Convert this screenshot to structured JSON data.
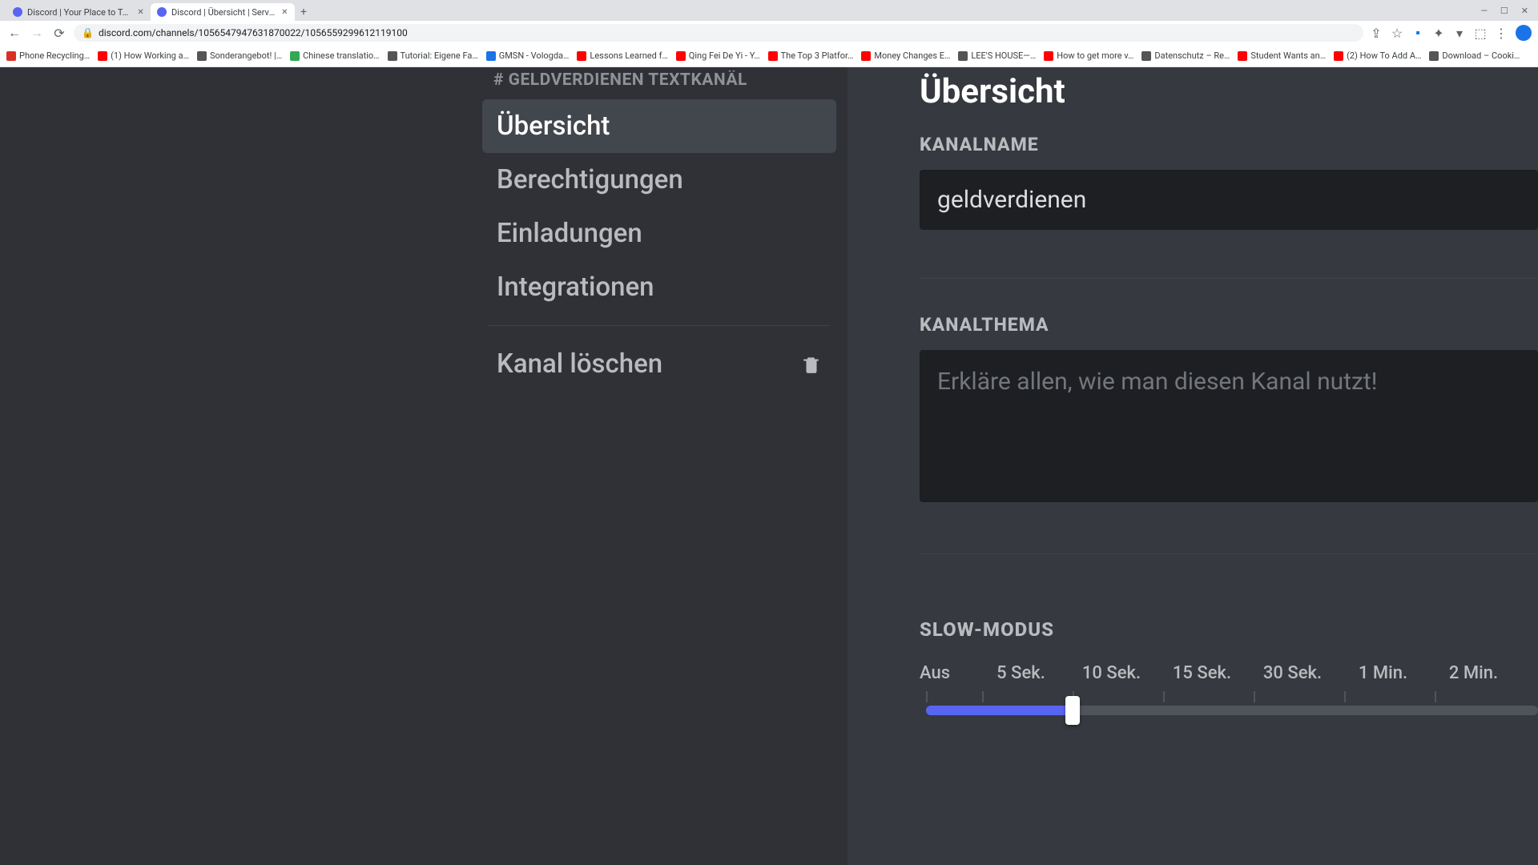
{
  "browser": {
    "tabs": [
      {
        "title": "Discord | Your Place to Talk an"
      },
      {
        "title": "Discord | Übersicht | Server v"
      }
    ],
    "url": "discord.com/channels/1056547947631870022/1056559299612119100",
    "bookmarks": [
      {
        "label": "Phone Recycling…",
        "color": "#d93025"
      },
      {
        "label": "(1) How Working a…",
        "color": "#ff0000"
      },
      {
        "label": "Sonderangebot! |…",
        "color": "#555"
      },
      {
        "label": "Chinese translatio…",
        "color": "#34a853"
      },
      {
        "label": "Tutorial: Eigene Fa…",
        "color": "#555"
      },
      {
        "label": "GMSN - Vologda…",
        "color": "#1a73e8"
      },
      {
        "label": "Lessons Learned f…",
        "color": "#ff0000"
      },
      {
        "label": "Qing Fei De Yi - Y…",
        "color": "#ff0000"
      },
      {
        "label": "The Top 3 Platfor…",
        "color": "#ff0000"
      },
      {
        "label": "Money Changes E…",
        "color": "#ff0000"
      },
      {
        "label": "LEE'S HOUSE—…",
        "color": "#555"
      },
      {
        "label": "How to get more v…",
        "color": "#ff0000"
      },
      {
        "label": "Datenschutz – Re…",
        "color": "#555"
      },
      {
        "label": "Student Wants an…",
        "color": "#ff0000"
      },
      {
        "label": "(2) How To Add A…",
        "color": "#ff0000"
      },
      {
        "label": "Download – Cooki…",
        "color": "#555"
      }
    ]
  },
  "sidebar": {
    "header": "# GELDVERDIENEN TEXTKANÄL",
    "items": [
      {
        "label": "Übersicht",
        "active": true
      },
      {
        "label": "Berechtigungen",
        "active": false
      },
      {
        "label": "Einladungen",
        "active": false
      },
      {
        "label": "Integrationen",
        "active": false
      }
    ],
    "delete_label": "Kanal löschen"
  },
  "content": {
    "title": "Übersicht",
    "channel_name_label": "KANALNAME",
    "channel_name_value": "geldverdienen",
    "topic_label": "KANALTHEMA",
    "topic_placeholder": "Erkläre allen, wie man diesen Kanal nutzt!",
    "slowmode_label": "SLOW-MODUS",
    "slowmode_ticks": [
      "Aus",
      "5 Sek.",
      "10 Sek.",
      "15 Sek.",
      "30 Sek.",
      "1 Min.",
      "2 Min."
    ],
    "slowmode_selected_index": 2
  }
}
